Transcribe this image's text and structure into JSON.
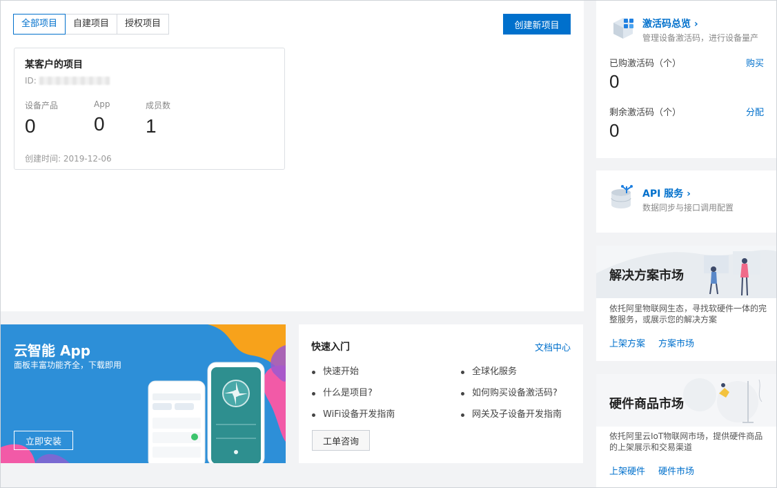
{
  "tabs": [
    "全部项目",
    "自建项目",
    "授权项目"
  ],
  "create_button": "创建新项目",
  "project": {
    "name": "某客户的项目",
    "id_label": "ID:",
    "stats": [
      {
        "label": "设备产品",
        "value": "0"
      },
      {
        "label": "App",
        "value": "0"
      },
      {
        "label": "成员数",
        "value": "1"
      }
    ],
    "created": "创建时间: 2019-12-06"
  },
  "promo": {
    "title": "云智能 App",
    "subtitle": "面板丰富功能齐全，下载即用",
    "install_button": "立即安装"
  },
  "quick_start": {
    "title": "快速入门",
    "doc_link": "文档中心",
    "left_items": [
      "快速开始",
      "什么是项目?",
      "WiFi设备开发指南"
    ],
    "right_items": [
      "全球化服务",
      "如何购买设备激活码?",
      "网关及子设备开发指南"
    ],
    "ticket_button": "工单咨询"
  },
  "activation": {
    "title": "激活码总览",
    "subtitle": "管理设备激活码，进行设备量产",
    "purchased_label": "已购激活码（个）",
    "purchased_link": "购买",
    "purchased_value": "0",
    "remaining_label": "剩余激活码（个）",
    "remaining_link": "分配",
    "remaining_value": "0"
  },
  "api": {
    "title": "API 服务",
    "subtitle": "数据同步与接口调用配置"
  },
  "solution_market": {
    "title": "解决方案市场",
    "desc": "依托阿里物联网生态，寻找软硬件一体的完整服务，或展示您的解决方案",
    "links": [
      "上架方案",
      "方案市场"
    ]
  },
  "hardware_market": {
    "title": "硬件商品市场",
    "desc": "依托阿里云IoT物联网市场，提供硬件商品的上架展示和交易渠道",
    "links": [
      "上架硬件",
      "硬件市场"
    ]
  },
  "colors": {
    "accent": "#0070cc",
    "promo_bg": "#2d8fd8"
  }
}
